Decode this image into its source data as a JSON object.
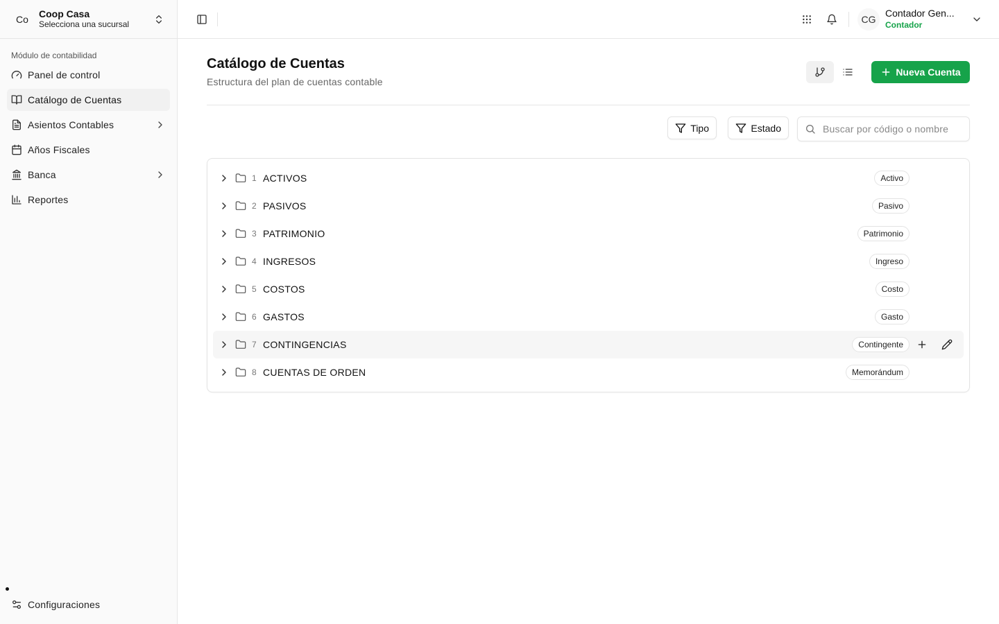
{
  "org": {
    "initials": "Co",
    "name": "Coop Casa",
    "subtitle": "Selecciona una sucursal"
  },
  "sidebar": {
    "group_label": "Módulo de contabilidad",
    "items": [
      {
        "label": "Panel de control",
        "icon": "gauge-icon"
      },
      {
        "label": "Catálogo de Cuentas",
        "icon": "book-open-icon",
        "active": true
      },
      {
        "label": "Asientos Contables",
        "icon": "file-text-icon",
        "has_children": true
      },
      {
        "label": "Años Fiscales",
        "icon": "calendar-icon"
      },
      {
        "label": "Banca",
        "icon": "landmark-icon",
        "has_children": true
      },
      {
        "label": "Reportes",
        "icon": "bar-chart-icon"
      }
    ],
    "footer_item": {
      "label": "Configuraciones",
      "icon": "settings-sliders-icon"
    }
  },
  "topbar": {
    "user": {
      "initials": "CG",
      "name": "Contador Gen...",
      "role": "Contador"
    }
  },
  "page": {
    "title": "Catálogo de Cuentas",
    "subtitle": "Estructura del plan de cuentas contable",
    "new_button": "Nueva Cuenta"
  },
  "filters": {
    "type_label": "Tipo",
    "status_label": "Estado",
    "search_placeholder": "Buscar por código o nombre"
  },
  "accounts": [
    {
      "code": "1",
      "name": "ACTIVOS",
      "type": "Activo"
    },
    {
      "code": "2",
      "name": "PASIVOS",
      "type": "Pasivo"
    },
    {
      "code": "3",
      "name": "PATRIMONIO",
      "type": "Patrimonio"
    },
    {
      "code": "4",
      "name": "INGRESOS",
      "type": "Ingreso"
    },
    {
      "code": "5",
      "name": "COSTOS",
      "type": "Costo"
    },
    {
      "code": "6",
      "name": "GASTOS",
      "type": "Gasto"
    },
    {
      "code": "7",
      "name": "CONTINGENCIAS",
      "type": "Contingente",
      "hovered": true
    },
    {
      "code": "8",
      "name": "CUENTAS DE ORDEN",
      "type": "Memorándum"
    }
  ],
  "colors": {
    "primary": "#16a34a",
    "border": "#e3e3e3",
    "sidebar_bg": "#fafafa"
  }
}
